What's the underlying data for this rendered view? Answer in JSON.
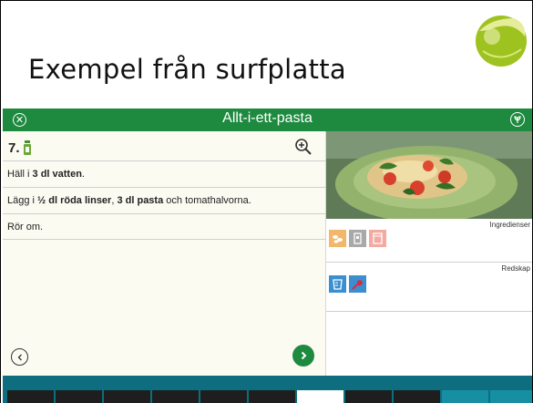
{
  "slide": {
    "title": "Exempel från surfplatta"
  },
  "app": {
    "header_title": "Allt-i-ett-pasta",
    "close_icon": "close-icon",
    "vegetarian_icon": "vegetarian-icon",
    "accent_color": "#1e8a3f",
    "bottom_bar_color": "#0e6e80"
  },
  "step": {
    "number": "7.",
    "icon": "stove-icon",
    "zoom_icon": "zoom-in-icon",
    "items": [
      {
        "parts": [
          {
            "t": "Häll i ",
            "b": false
          },
          {
            "t": "3 dl vatten",
            "b": true
          },
          {
            "t": ".",
            "b": false
          }
        ]
      },
      {
        "parts": [
          {
            "t": "Lägg i ",
            "b": false
          },
          {
            "t": "½ dl röda linser",
            "b": true
          },
          {
            "t": ", ",
            "b": false
          },
          {
            "t": "3 dl pasta",
            "b": true
          },
          {
            "t": " och tomathalvorna.",
            "b": false
          }
        ]
      },
      {
        "parts": [
          {
            "t": "Rör om.",
            "b": false
          }
        ]
      }
    ],
    "prev_icon": "chevron-left-icon",
    "next_icon": "chevron-right-icon"
  },
  "side": {
    "ingredients_label": "Ingredienser",
    "equipment_label": "Redskap",
    "ingredient_icons": [
      "lentils-icon",
      "pasta-package-icon",
      "tomato-icon"
    ],
    "equipment_icons": [
      "measuring-cup-icon",
      "spatula-icon"
    ]
  },
  "progress": {
    "segments": [
      "done",
      "done",
      "done",
      "done",
      "done",
      "done",
      "current",
      "done",
      "done",
      "upcoming",
      "upcoming"
    ]
  }
}
